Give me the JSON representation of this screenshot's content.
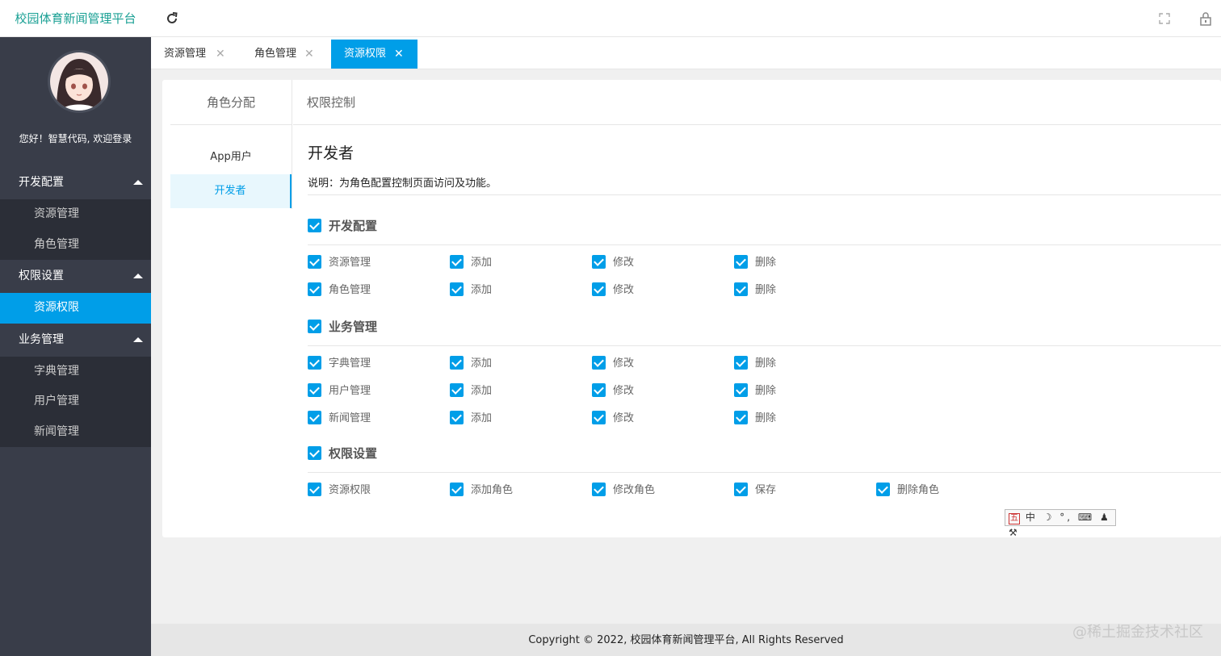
{
  "brand": "校园体育新闻管理平台",
  "welcome": "您好！智慧代码, 欢迎登录",
  "menu": [
    {
      "title": "开发配置",
      "items": [
        "资源管理",
        "角色管理"
      ]
    },
    {
      "title": "权限设置",
      "items": [
        "资源权限"
      ]
    },
    {
      "title": "业务管理",
      "items": [
        "字典管理",
        "用户管理",
        "新闻管理"
      ]
    }
  ],
  "tabs": [
    "资源管理",
    "角色管理",
    "资源权限"
  ],
  "active_tab": "资源权限",
  "panel": {
    "left_header": "角色分配",
    "right_header": "权限控制",
    "roles": [
      "App用户",
      "开发者"
    ],
    "role_title": "开发者",
    "description": "说明：为角色配置控制页面访问及功能。"
  },
  "groups": [
    {
      "title": "开发配置",
      "rows": [
        [
          "资源管理",
          "添加",
          "修改",
          "删除"
        ],
        [
          "角色管理",
          "添加",
          "修改",
          "删除"
        ]
      ]
    },
    {
      "title": "业务管理",
      "rows": [
        [
          "字典管理",
          "添加",
          "修改",
          "删除"
        ],
        [
          "用户管理",
          "添加",
          "修改",
          "删除"
        ],
        [
          "新闻管理",
          "添加",
          "修改",
          "删除"
        ]
      ]
    },
    {
      "title": "权限设置",
      "rows": [
        [
          "资源权限",
          "添加角色",
          "修改角色",
          "保存",
          "删除角色"
        ]
      ]
    }
  ],
  "ime_bar": {
    "wu": "五",
    "rest": "中 ☽ °, ⌨ ♟ ⚒"
  },
  "footer": "Copyright © 2022, 校园体育新闻管理平台, All Rights Reserved",
  "watermark": "@稀土掘金技术社区",
  "colors": {
    "accent": "#009ee8",
    "sidebar": "#393d49",
    "brand": "#1aa094"
  }
}
